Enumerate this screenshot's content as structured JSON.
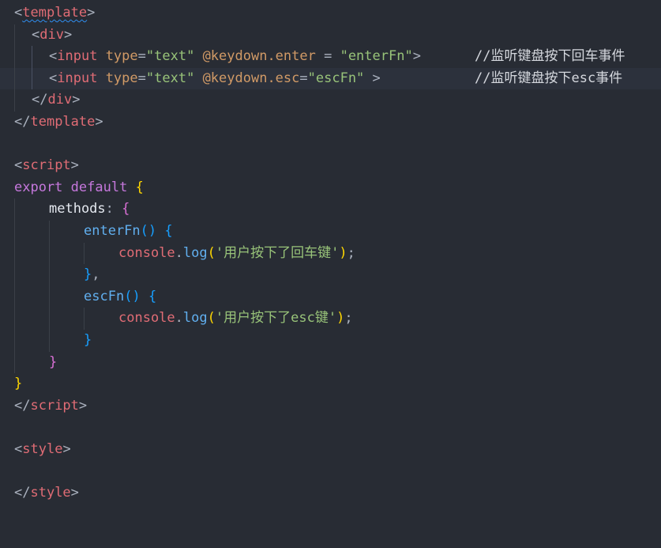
{
  "code": {
    "t_lt": "<",
    "t_gt": ">",
    "t_lts": "</",
    "t_template": "template",
    "t_div": "div",
    "t_input": "input",
    "t_script": "script",
    "t_style": "style",
    "a_type": "type",
    "a_eq": "=",
    "a_eq_sp": " = ",
    "v_text": "\"text\"",
    "a_enter": "@keydown.enter",
    "v_enterFn": "\"enterFn\"",
    "a_esc": "@keydown.esc",
    "v_escFn": "\"escFn\"",
    "c1": "//监听键盘按下回车事件",
    "c2": "//监听键盘按下esc事件",
    "kw_export": "export",
    "kw_default": "default",
    "methods": "methods",
    "colon": ":",
    "fn_enter": "enterFn",
    "fn_esc": "escFn",
    "console": "console",
    "dot": ".",
    "log": "log",
    "s1": "'用户按下了回车键'",
    "s2": "'用户按下了esc键'",
    "semi": ";",
    "comma": ",",
    "lbrace": "{",
    "rbrace": "}",
    "lparen": "(",
    "rparen": ")"
  }
}
